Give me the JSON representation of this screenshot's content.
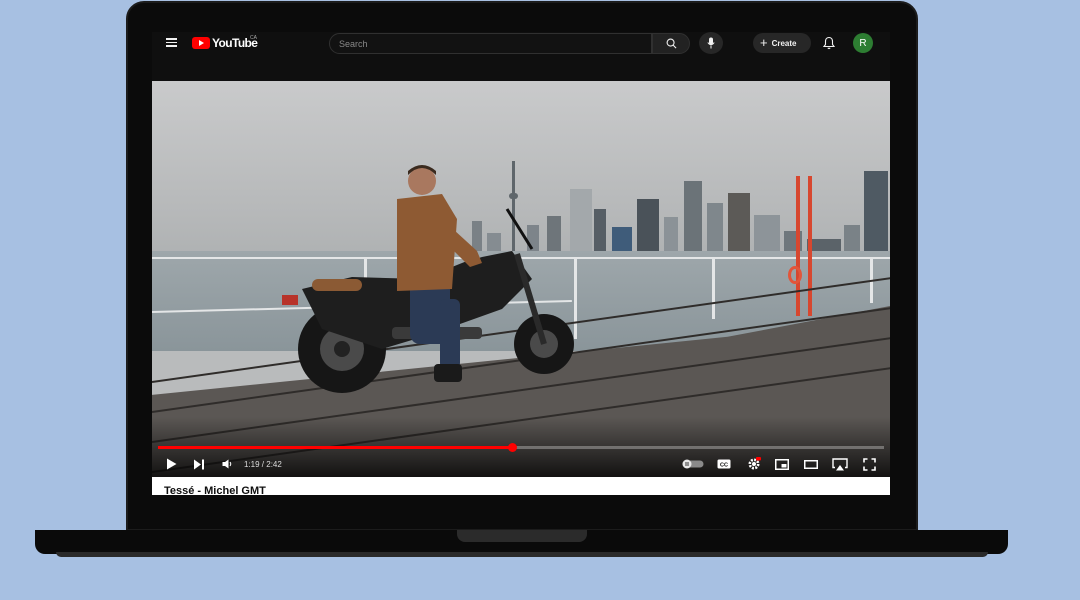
{
  "header": {
    "logo_text": "YouTube",
    "logo_region": "CA",
    "search_placeholder": "Search",
    "create_label": "Create",
    "avatar_letter": "R"
  },
  "player": {
    "current_time": "1:19",
    "duration": "2:42",
    "time_display": "1:19 / 2:42",
    "progress_fraction": 0.487,
    "buffered_fraction": 0.49
  },
  "video": {
    "title": "Tessé - Michel GMT"
  },
  "colors": {
    "accent": "#ff0000",
    "background": "#a7c0e2",
    "avatar": "#2d7d32"
  }
}
